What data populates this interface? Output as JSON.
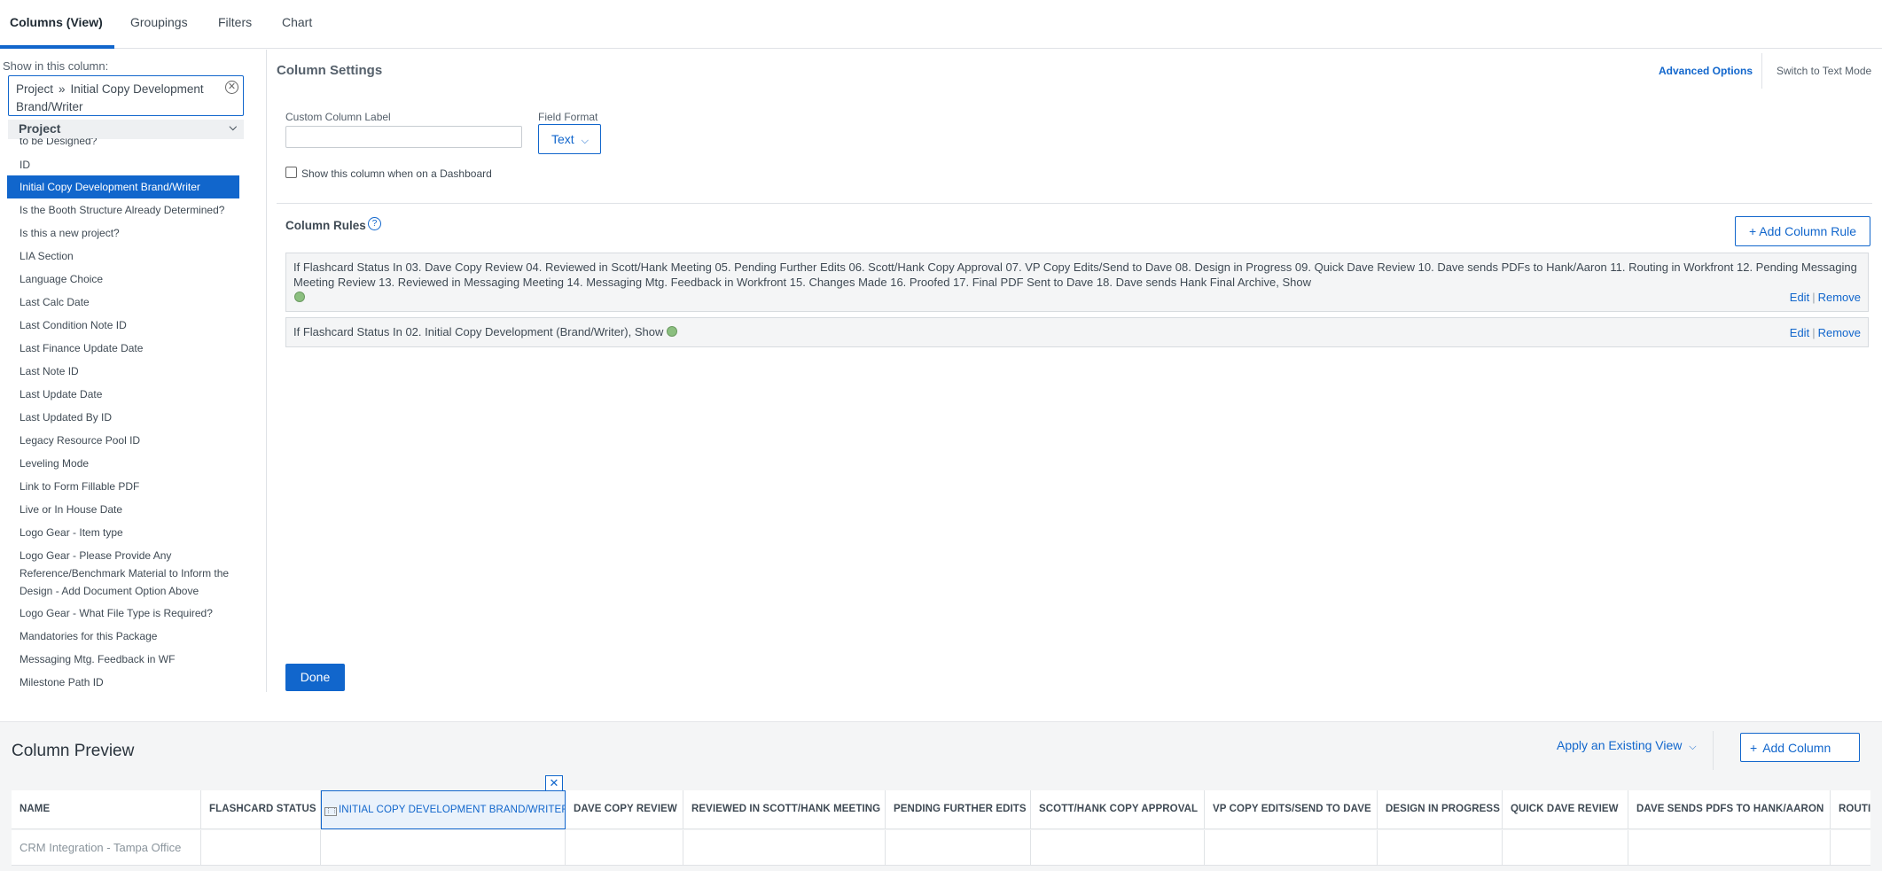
{
  "tabs": [
    {
      "label": "Columns (View)",
      "active": true
    },
    {
      "label": "Groupings",
      "active": false
    },
    {
      "label": "Filters",
      "active": false
    },
    {
      "label": "Chart",
      "active": false
    }
  ],
  "left_panel": {
    "show_label": "Show in this column:",
    "selected_path": {
      "part1": "Project",
      "separator": "»",
      "part2": "Initial Copy Development Brand/Writer"
    },
    "group": "Project",
    "fields": [
      {
        "label": "to be Designed?",
        "selected": false
      },
      {
        "label": "ID",
        "selected": false
      },
      {
        "label": "Initial Copy Development Brand/Writer",
        "selected": true
      },
      {
        "label": "Is the Booth Structure Already Determined?",
        "selected": false
      },
      {
        "label": "Is this a new project?",
        "selected": false
      },
      {
        "label": "LIA Section",
        "selected": false
      },
      {
        "label": "Language Choice",
        "selected": false
      },
      {
        "label": "Last Calc Date",
        "selected": false
      },
      {
        "label": "Last Condition Note ID",
        "selected": false
      },
      {
        "label": "Last Finance Update Date",
        "selected": false
      },
      {
        "label": "Last Note ID",
        "selected": false
      },
      {
        "label": "Last Update Date",
        "selected": false
      },
      {
        "label": "Last Updated By ID",
        "selected": false
      },
      {
        "label": "Legacy Resource Pool ID",
        "selected": false
      },
      {
        "label": "Leveling Mode",
        "selected": false
      },
      {
        "label": "Link to Form Fillable PDF",
        "selected": false
      },
      {
        "label": "Live or In House Date",
        "selected": false
      },
      {
        "label": "Logo Gear - Item type",
        "selected": false
      },
      {
        "label": "Logo Gear - Please Provide Any Reference/Benchmark Material to Inform the Design - Add Document Option Above",
        "selected": false
      },
      {
        "label": "Logo Gear - What File Type is Required?",
        "selected": false
      },
      {
        "label": "Mandatories for this Package",
        "selected": false
      },
      {
        "label": "Messaging Mtg. Feedback in WF",
        "selected": false
      },
      {
        "label": "Milestone Path ID",
        "selected": false
      }
    ]
  },
  "settings": {
    "title": "Column Settings",
    "advanced_options": "Advanced Options",
    "switch_mode": "Switch to Text Mode",
    "custom_label": "Custom Column Label",
    "custom_label_value": "",
    "field_format_label": "Field Format",
    "field_format_value": "Text",
    "dashboard_checkbox": "Show this column when on a Dashboard",
    "rules_title": "Column Rules",
    "add_rule": "+ Add Column Rule",
    "rules": [
      {
        "text": "If Flashcard Status In 03. Dave Copy Review 04. Reviewed in Scott/Hank Meeting 05. Pending Further Edits 06. Scott/Hank Copy Approval 07. VP Copy Edits/Send to Dave 08. Design in Progress 09. Quick Dave Review 10. Dave sends PDFs to Hank/Aaron 11. Routing in Workfront 12. Pending Messaging Meeting Review 13. Reviewed in Messaging Meeting 14. Messaging Mtg. Feedback in Workfront 15. Changes Made 16. Proofed 17. Final PDF Sent to Dave 18. Dave sends Hank Final Archive, Show",
        "edit": "Edit",
        "remove": "Remove"
      },
      {
        "text": "If Flashcard Status In 02. Initial Copy Development (Brand/Writer), Show",
        "edit": "Edit",
        "remove": "Remove"
      }
    ],
    "done": "Done"
  },
  "preview": {
    "title": "Column Preview",
    "apply_view": "Apply an Existing View",
    "add_column": "Add Column",
    "headers": [
      "NAME",
      "FLASHCARD STATUS",
      "INITIAL COPY DEVELOPMENT BRAND/WRITER",
      "DAVE COPY REVIEW",
      "REVIEWED IN SCOTT/HANK MEETING",
      "PENDING FURTHER EDITS",
      "SCOTT/HANK COPY APPROVAL",
      "VP COPY EDITS/SEND TO DAVE",
      "DESIGN IN PROGRESS",
      "QUICK DAVE REVIEW",
      "DAVE SENDS PDFS TO HANK/AARON",
      "ROUTI"
    ],
    "row": [
      "CRM Integration - Tampa Office",
      "",
      "",
      "",
      "",
      "",
      "",
      "",
      "",
      "",
      "",
      ""
    ]
  },
  "colors": {
    "accent": "#1166cc",
    "rule_bg": "#f4f5f6",
    "status_dot": "#8bbf7f"
  }
}
